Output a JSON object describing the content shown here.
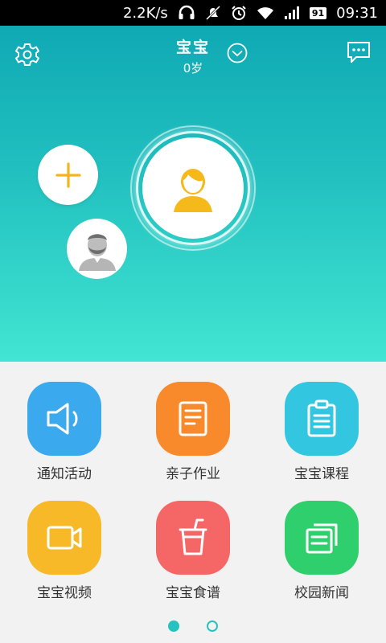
{
  "status_bar": {
    "speed": "2.2K/s",
    "battery": "91",
    "time": "09:31"
  },
  "header": {
    "name": "宝宝",
    "age": "0岁"
  },
  "colors": {
    "accent": "#27c2c0",
    "tile_notice": "#3aa9ee",
    "tile_homework": "#f98a2b",
    "tile_course": "#33c6e0",
    "tile_video": "#f7b928",
    "tile_recipe": "#f56767",
    "tile_news": "#2fcf6d"
  },
  "grid": {
    "items": [
      {
        "label": "通知活动",
        "icon": "speaker-icon"
      },
      {
        "label": "亲子作业",
        "icon": "document-icon"
      },
      {
        "label": "宝宝课程",
        "icon": "clipboard-icon"
      },
      {
        "label": "宝宝视频",
        "icon": "video-camera-icon"
      },
      {
        "label": "宝宝食谱",
        "icon": "cup-icon"
      },
      {
        "label": "校园新闻",
        "icon": "news-icon"
      }
    ]
  },
  "pager": {
    "current": 1,
    "total": 2
  }
}
